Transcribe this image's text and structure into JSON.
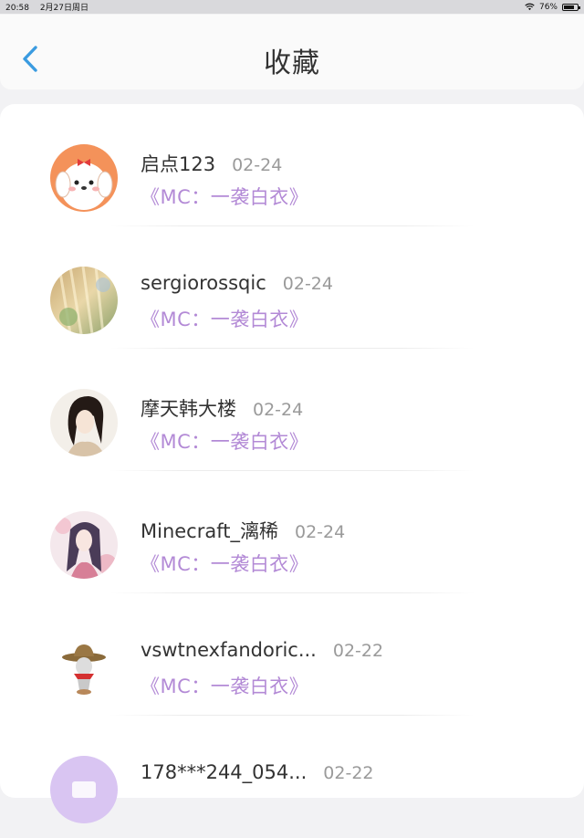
{
  "status_bar": {
    "time": "20:58",
    "date": "2月27日周日",
    "battery": "76%",
    "battery_level": 0.76
  },
  "header": {
    "title": "收藏"
  },
  "favorites": [
    {
      "name": "启点123",
      "date": "02-24",
      "book": "《MC：一袭白衣》",
      "avatar": "cartoon-dog-avatar"
    },
    {
      "name": "sergiorossqic",
      "date": "02-24",
      "book": "《MC：一袭白衣》",
      "avatar": "sunlight-forest-avatar"
    },
    {
      "name": "摩天韩大楼",
      "date": "02-24",
      "book": "《MC：一袭白衣》",
      "avatar": "sketch-girl-avatar"
    },
    {
      "name": "Minecraft_漓稀",
      "date": "02-24",
      "book": "《MC：一袭白衣》",
      "avatar": "anime-girl-avatar"
    },
    {
      "name": "vswtnexfandoric...",
      "date": "02-22",
      "book": "《MC：一袭白衣》",
      "avatar": "cowboy-figure-avatar"
    },
    {
      "name": "178***244_054...",
      "date": "02-22",
      "book": "",
      "avatar": "default-purple-avatar"
    }
  ],
  "colors": {
    "accent_back": "#3a9be0",
    "book_title": "#b38ad6",
    "date": "#9a9a9a"
  }
}
